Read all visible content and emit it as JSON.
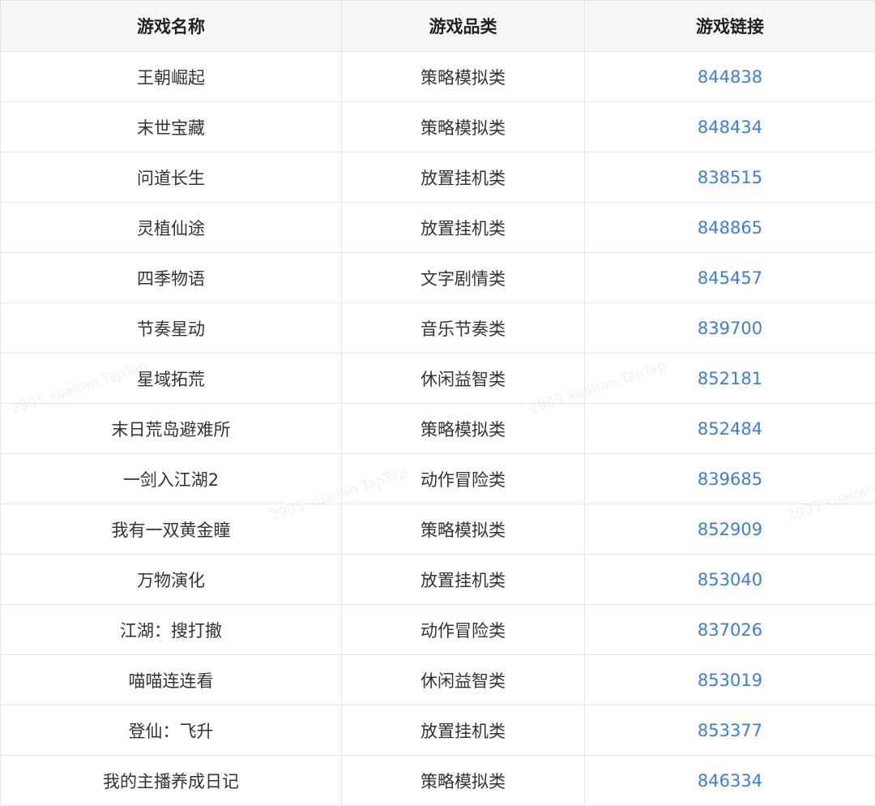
{
  "table": {
    "headers": [
      "游戏名称",
      "游戏品类",
      "游戏链接"
    ],
    "rows": [
      {
        "name": "王朝崛起",
        "category": "策略模拟类",
        "link": "844838"
      },
      {
        "name": "末世宝藏",
        "category": "策略模拟类",
        "link": "848434"
      },
      {
        "name": "问道长生",
        "category": "放置挂机类",
        "link": "838515"
      },
      {
        "name": "灵植仙途",
        "category": "放置挂机类",
        "link": "848865"
      },
      {
        "name": "四季物语",
        "category": "文字剧情类",
        "link": "845457"
      },
      {
        "name": "节奏星动",
        "category": "音乐节奏类",
        "link": "839700"
      },
      {
        "name": "星域拓荒",
        "category": "休闲益智类",
        "link": "852181"
      },
      {
        "name": "末日荒岛避难所",
        "category": "策略模拟类",
        "link": "852484"
      },
      {
        "name": "一剑入江湖2",
        "category": "动作冒险类",
        "link": "839685"
      },
      {
        "name": "我有一双黄金瞳",
        "category": "策略模拟类",
        "link": "852909"
      },
      {
        "name": "万物演化",
        "category": "放置挂机类",
        "link": "853040"
      },
      {
        "name": "江湖：搜打撤",
        "category": "动作冒险类",
        "link": "837026"
      },
      {
        "name": "喵喵连连看",
        "category": "休闲益智类",
        "link": "853019"
      },
      {
        "name": "登仙：飞升",
        "category": "放置挂机类",
        "link": "853377"
      },
      {
        "name": "我的主播养成日记",
        "category": "策略模拟类",
        "link": "846334"
      }
    ]
  },
  "watermark": "2905 xuairan TapTap",
  "colors": {
    "header_bg": "#f5f6f7",
    "border": "#e6e6e6",
    "link": "#3b7de0",
    "text": "#333333"
  }
}
